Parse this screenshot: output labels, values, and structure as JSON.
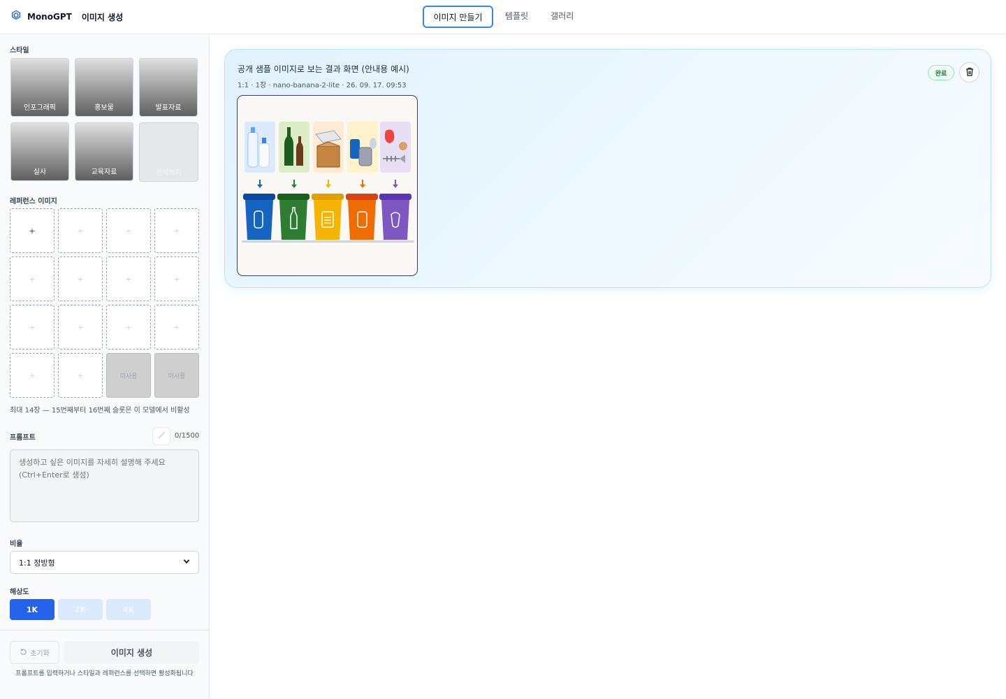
{
  "header": {
    "brand_name": "MonoGPT",
    "section_title": "이미지 생성",
    "tabs": [
      "이미지 만들기",
      "템플릿",
      "갤러리"
    ],
    "active_tab": "이미지 만들기"
  },
  "sidebar": {
    "style_label": "스타일",
    "styles": [
      "인포그래픽",
      "홍보물",
      "발표자료",
      "실사",
      "교육자료",
      "전체보기"
    ],
    "reference_label": "레퍼런스 이미지",
    "reference_add": "+",
    "reference_disabled": "미사용",
    "reference_note": "최대 14장 — 15번째부터 16번째 슬롯은 이 모델에서 비활성",
    "prompt_label": "프롬프트",
    "prompt_count": "0/1500",
    "prompt_placeholder": "생성하고 싶은 이미지를 자세히 설명해 주세요 (Ctrl+Enter로 생성)",
    "ratio_label": "비율",
    "ratio_value": "1:1 정방형",
    "resolution_label": "해상도",
    "resolutions": [
      "1K",
      "2K",
      "4K"
    ],
    "selected_resolution": "1K",
    "reset_label": "초기화",
    "generate_label": "이미지 생성",
    "generate_hint": "프롬프트를 입력하거나 스타일과 레퍼런스를 선택하면 활성화됩니다"
  },
  "result": {
    "title": "공개 샘플 이미지로 보는 결과 화면 (안내용 예시)",
    "meta": "1:1 · 1장 · nano-banana-2-lite · 26. 09. 17. 09:53",
    "status": "완료"
  },
  "colors": {
    "accent": "#2563eb",
    "bin_blue": "#1565c0",
    "bin_green": "#2e7d32",
    "bin_yellow": "#f4b400",
    "bin_orange": "#ef6c00",
    "bin_purple": "#7e57c2"
  }
}
